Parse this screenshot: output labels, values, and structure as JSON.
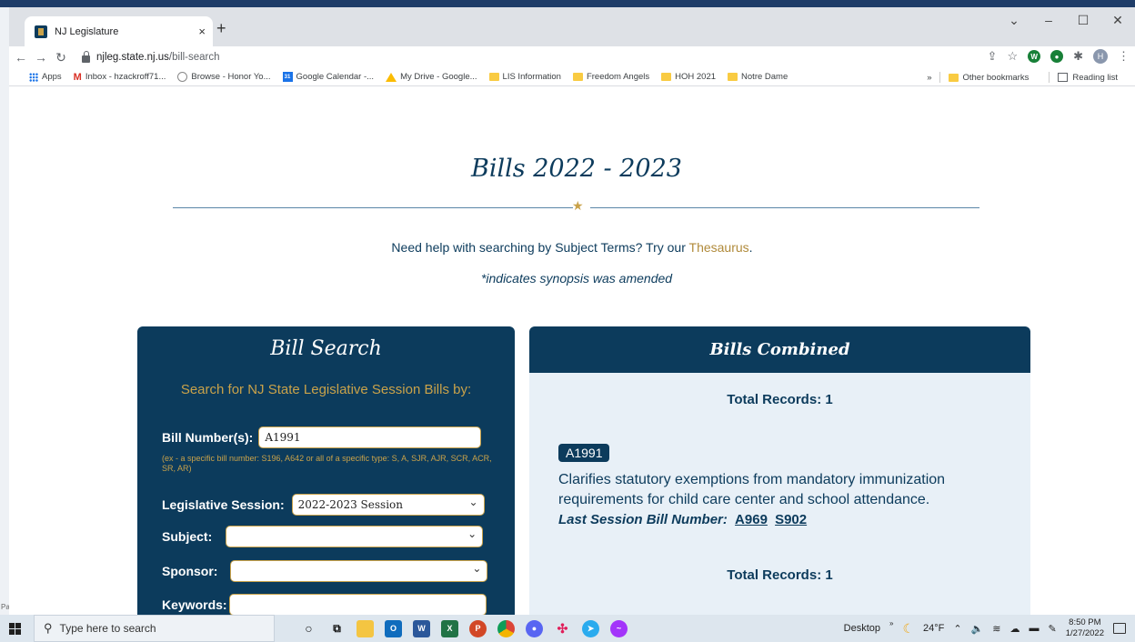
{
  "browser": {
    "tab_title": "NJ Legislature",
    "tab_close": "×",
    "new_tab": "+",
    "window_controls": [
      "⌄",
      "–",
      "☐",
      "✕"
    ],
    "url_domain": "njleg.state.nj.us",
    "url_path": "/bill-search",
    "avatar_letter": "H",
    "bookmarks": [
      {
        "label": "Apps",
        "icon": "apps-grid-icon"
      },
      {
        "label": "Inbox - hzackroff71...",
        "icon": "gmail-icon"
      },
      {
        "label": "Browse - Honor Yo...",
        "icon": "honor-icon"
      },
      {
        "label": "Google Calendar -...",
        "icon": "calendar-icon"
      },
      {
        "label": "My Drive - Google...",
        "icon": "drive-icon"
      },
      {
        "label": "LIS Information",
        "icon": "folder-icon"
      },
      {
        "label": "Freedom Angels",
        "icon": "folder-icon"
      },
      {
        "label": "HOH 2021",
        "icon": "folder-icon"
      },
      {
        "label": "Notre Dame",
        "icon": "folder-icon"
      }
    ],
    "overflow": "»",
    "other_bookmarks": "Other bookmarks",
    "reading_list": "Reading list"
  },
  "page": {
    "title": "Bills 2022 - 2023",
    "help_text": "Need help with searching by Subject Terms? Try our ",
    "help_link": "Thesaurus",
    "help_end": ".",
    "note": "*indicates synopsis was amended"
  },
  "search": {
    "title": "Bill Search",
    "subtitle": "Search for NJ State Legislative Session Bills by:",
    "bill_number_label": "Bill Number(s):",
    "bill_number_value": "A1991",
    "hint": "(ex - a specific bill number: S196, A642 or all of a specific type: S, A, SJR, AJR, SCR, ACR, SR, AR)",
    "session_label": "Legislative Session:",
    "session_value": "2022-2023 Session",
    "subject_label": "Subject:",
    "sponsor_label": "Sponsor:",
    "keywords_label": "Keywords:"
  },
  "results": {
    "title": "Bills Combined",
    "total_records": "Total Records: 1",
    "bill_badge": "A1991",
    "synopsis": "Clarifies statutory exemptions from mandatory immunization requirements for child care center and school attendance.",
    "last_session_label": "Last Session Bill Number:",
    "last_session_bills": [
      "A969",
      "S902"
    ],
    "total_records_bottom": "Total Records: 1"
  },
  "taskbar": {
    "search_placeholder": "Type here to search",
    "desktop_label": "Desktop",
    "chevron": "»",
    "weather": "24°F",
    "time": "8:50 PM",
    "date": "1/27/2022"
  },
  "desktop": {
    "left_edge_text": "Pa"
  }
}
